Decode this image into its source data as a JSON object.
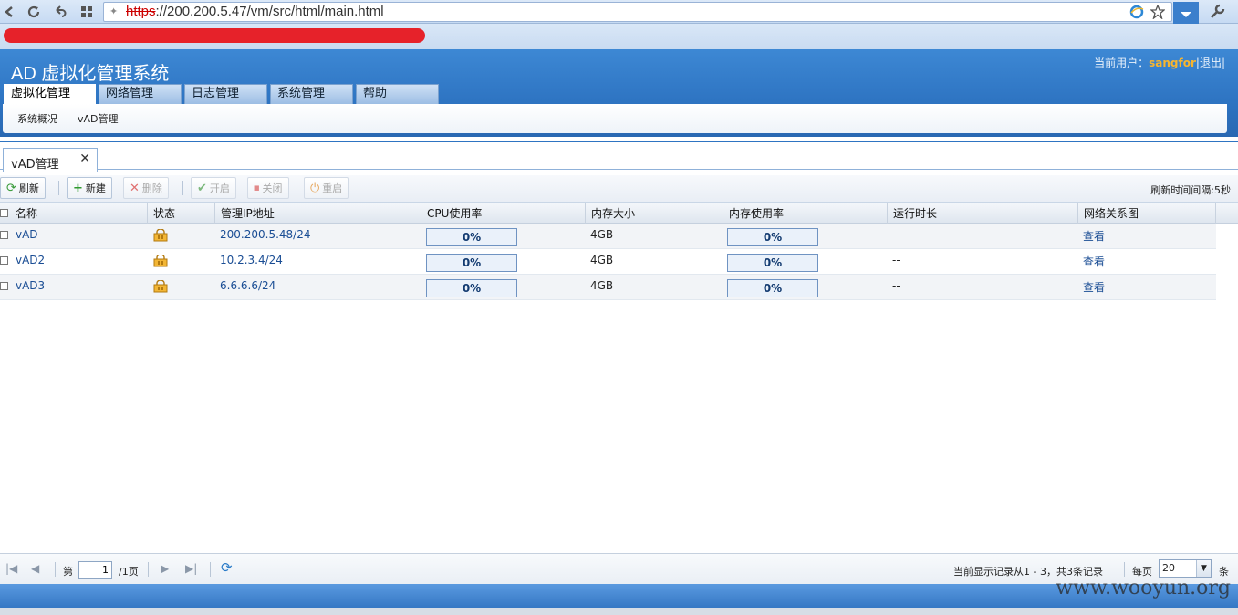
{
  "browser": {
    "url_scheme": "https",
    "url_rest": "://200.200.5.47/vm/src/html/main.html"
  },
  "app": {
    "title": "AD 虚拟化管理系统",
    "user_label": "当前用户：",
    "user_name": "sangfor",
    "logout_label": "退出",
    "sep": "|"
  },
  "main_tabs": [
    "虚拟化管理",
    "网络管理",
    "日志管理",
    "系统管理",
    "帮助"
  ],
  "sub_menu": [
    "系统概况",
    "vAD管理"
  ],
  "panel_tab": {
    "label": "vAD管理",
    "close": "✕"
  },
  "toolbar": {
    "refresh": "刷新",
    "new": "新建",
    "delete": "删除",
    "start": "开启",
    "stop": "关闭",
    "restart": "重启",
    "refresh_interval": "刷新时间间隔:5秒"
  },
  "table": {
    "columns": [
      "名称",
      "状态",
      "管理IP地址",
      "CPU使用率",
      "内存大小",
      "内存使用率",
      "运行时长",
      "网络关系图"
    ],
    "rows": [
      {
        "name": "vAD",
        "ip": "200.200.5.48/24",
        "cpu": "0%",
        "cpu_value": 0,
        "mem": "4GB",
        "mem_usage": "0%",
        "mem_value": 0,
        "uptime": "--",
        "view": "查看"
      },
      {
        "name": "vAD2",
        "ip": "10.2.3.4/24",
        "cpu": "0%",
        "cpu_value": 0,
        "mem": "4GB",
        "mem_usage": "0%",
        "mem_value": 0,
        "uptime": "--",
        "view": "查看"
      },
      {
        "name": "vAD3",
        "ip": "6.6.6.6/24",
        "cpu": "0%",
        "cpu_value": 0,
        "mem": "4GB",
        "mem_usage": "0%",
        "mem_value": 0,
        "uptime": "--",
        "view": "查看"
      }
    ]
  },
  "paging": {
    "page_prefix": "第",
    "page_value": "1",
    "page_suffix": "/1页",
    "display_info": "当前显示记录从1  -  3，共3条记录",
    "per_page_label": "每页",
    "per_page_value": "20",
    "per_page_suffix": "条"
  },
  "watermark": "www.wooyun.org",
  "colors": {
    "accent": "#2e74c2",
    "link": "#1a4d94",
    "user": "#f6b530",
    "redaction": "#e6222a"
  }
}
